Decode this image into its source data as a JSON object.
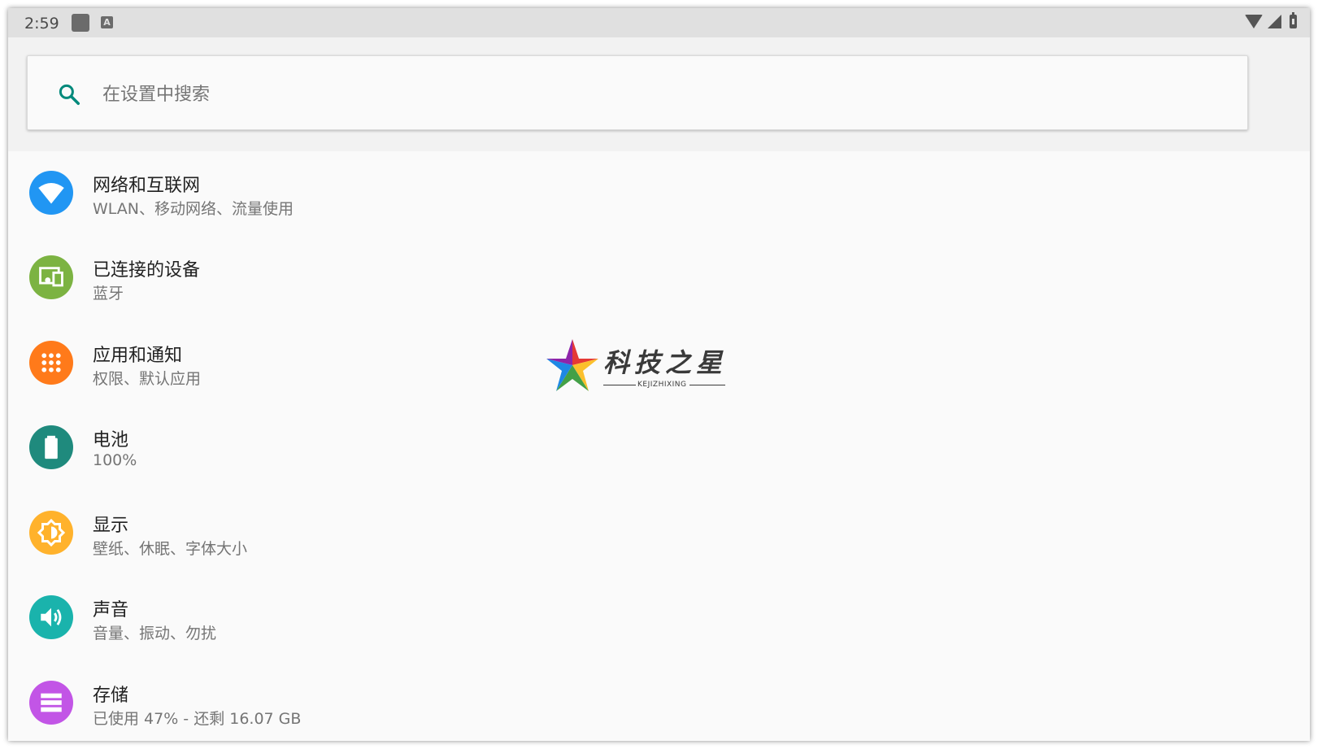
{
  "status_bar": {
    "time": "2:59",
    "notif_b": "A"
  },
  "search": {
    "placeholder": "在设置中搜索",
    "value": ""
  },
  "settings": [
    {
      "title": "网络和互联网",
      "subtitle": "WLAN、移动网络、流量使用",
      "icon": "wifi-icon",
      "color": "#2196f3"
    },
    {
      "title": "已连接的设备",
      "subtitle": "蓝牙",
      "icon": "devices-icon",
      "color": "#7cb342"
    },
    {
      "title": "应用和通知",
      "subtitle": "权限、默认应用",
      "icon": "apps-icon",
      "color": "#ff7a1a"
    },
    {
      "title": "电池",
      "subtitle": "100%",
      "icon": "battery-icon",
      "color": "#1f8a7d"
    },
    {
      "title": "显示",
      "subtitle": "壁纸、休眠、字体大小",
      "icon": "brightness-icon",
      "color": "#ffb22c"
    },
    {
      "title": "声音",
      "subtitle": "音量、振动、勿扰",
      "icon": "volume-icon",
      "color": "#1ab3ac"
    },
    {
      "title": "存储",
      "subtitle": "已使用 47% - 还剩 16.07 GB",
      "icon": "storage-icon",
      "color": "#c255e6"
    }
  ],
  "watermark": {
    "title": "科技之星",
    "subtitle": "KEJIZHIXING"
  }
}
